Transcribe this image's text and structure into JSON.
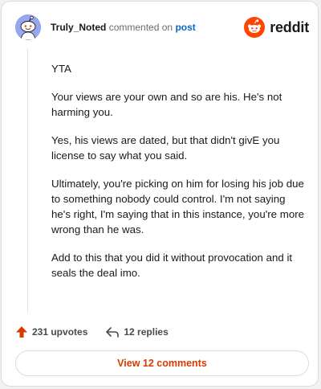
{
  "comment": {
    "author": "Truly_Noted",
    "action_text": "commented on",
    "target_link": "post",
    "paragraphs": [
      "YTA",
      "Your views are your own and so are his. He's not harming you.",
      "Yes, his views are dated, but that didn't givE you license to say what you said.",
      "Ultimately, you're picking on him for losing his job due to something nobody could control. I'm not saying he's right, I'm saying that in this instance, you're more wrong than he was.",
      "Add to this that you did it without provocation and it seals the deal imo."
    ]
  },
  "brand": {
    "name": "reddit",
    "color": "#ff4500"
  },
  "actions": {
    "upvotes": "231 upvotes",
    "replies": "12 replies"
  },
  "view_button": {
    "label": "View 12 comments"
  },
  "colors": {
    "accent": "#d93a00",
    "link": "#0a66c2",
    "upvote": "#d93a00",
    "avatar_bg": "#96a6ef"
  },
  "icons": [
    "snoo-avatar-icon",
    "reddit-logo-icon",
    "upvote-arrow-icon",
    "reply-arrow-icon"
  ]
}
